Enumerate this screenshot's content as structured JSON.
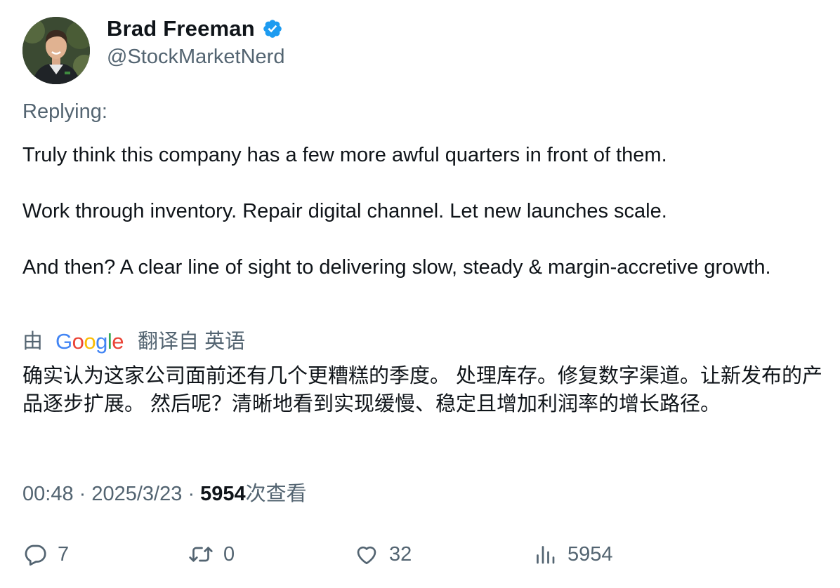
{
  "author": {
    "display_name": "Brad Freeman",
    "handle": "@StockMarketNerd",
    "verified": true
  },
  "replying_label": "Replying:",
  "tweet": {
    "paragraphs": [
      "Truly think this company has a few more awful quarters in front of them.",
      "Work through inventory. Repair digital channel. Let new launches scale.",
      "And then? A clear line of sight to delivering slow, steady & margin-accretive growth."
    ]
  },
  "translation": {
    "prefix": "由",
    "provider": "Google",
    "suffix": "翻译自 英语",
    "text": "确实认为这家公司面前还有几个更糟糕的季度。 处理库存。修复数字渠道。让新发布的产品逐步扩展。 然后呢？清晰地看到实现缓慢、稳定且增加利润率的增长路径。"
  },
  "meta": {
    "time": "00:48",
    "separator": "·",
    "date": "2025/3/23",
    "views_count": "5954",
    "views_label": "次查看"
  },
  "actions": {
    "replies": "7",
    "retweets": "0",
    "likes": "32",
    "views": "5954"
  },
  "colors": {
    "text_primary": "#0f1419",
    "text_secondary": "#536471",
    "verified_blue": "#1d9bf0",
    "google_blue": "#4285F4",
    "google_red": "#EA4335",
    "google_yellow": "#FBBC05",
    "google_green": "#34A853"
  },
  "icons": {
    "verified": "verified-badge-icon",
    "reply": "speech-bubble-icon",
    "retweet": "retweet-arrows-icon",
    "like": "heart-icon",
    "views": "bar-chart-icon"
  }
}
